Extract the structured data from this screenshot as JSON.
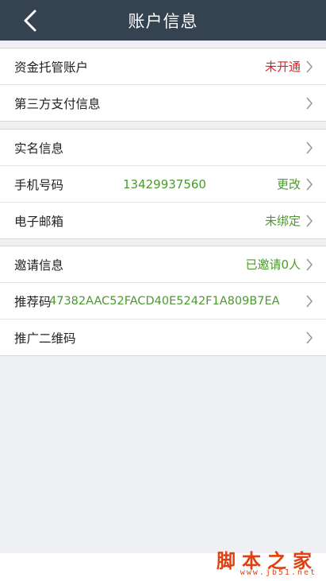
{
  "header": {
    "title": "账户信息",
    "back_icon": "chevron-left-icon"
  },
  "groups": [
    {
      "rows": [
        {
          "label": "资金托管账户",
          "value": "未开通",
          "value_color": "#e02020"
        },
        {
          "label": "第三方支付信息",
          "value": ""
        }
      ]
    },
    {
      "rows": [
        {
          "label": "实名信息",
          "value": ""
        },
        {
          "label": "手机号码",
          "middle": "13429937560",
          "value": "更改",
          "value_color": "#4a9a2c"
        },
        {
          "label": "电子邮箱",
          "value": "未绑定",
          "value_color": "#4a9a2c"
        }
      ]
    },
    {
      "rows": [
        {
          "label": "邀请信息",
          "value": "已邀请0人",
          "value_color": "#4a9a2c"
        },
        {
          "label": "推荐码",
          "middle": "47382AAC52FACD40E5242F1A809B7EA"
        },
        {
          "label": "推广二维码",
          "value": ""
        }
      ]
    }
  ],
  "watermark": {
    "text": "脚本之家",
    "url": "www.jb51.net"
  },
  "colors": {
    "header_bg": "#35424f",
    "accent_green": "#4a9a2c",
    "alert_red": "#e02020",
    "watermark": "#e04010"
  }
}
